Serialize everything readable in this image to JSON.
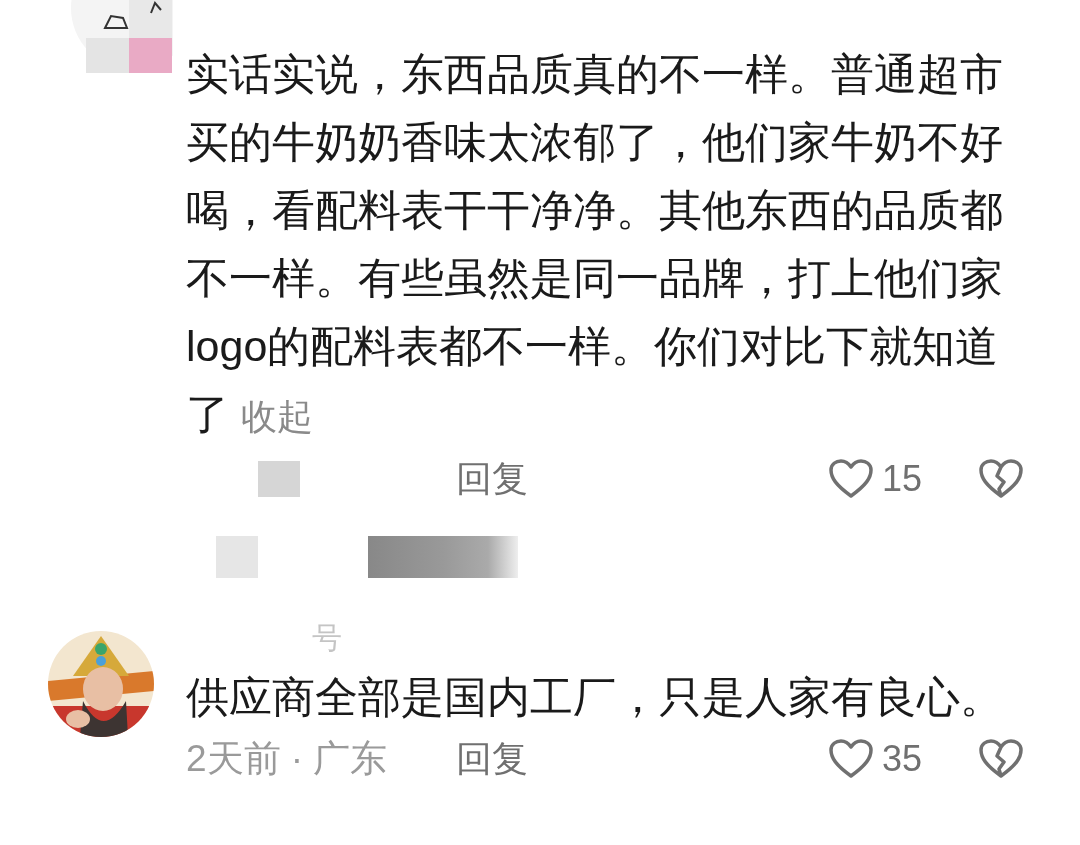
{
  "comments": [
    {
      "text": "实话实说，东西品质真的不一样。普通超市买的牛奶奶香味太浓郁了，他们家牛奶不好喝，看配料表干干净净。其他东西的品质都不一样。有些虽然是同一品牌，打上他们家logo的配料表都不一样。你们对比下就知道了",
      "collapse": "收起",
      "redacted_meta": true,
      "reply": "回复",
      "likes": "15",
      "reply_preview_redacted": true
    },
    {
      "username": "号",
      "text": "供应商全部是国内工厂，只是人家有良心。",
      "meta": "2天前 · 广东",
      "redacted_meta": false,
      "reply": "回复",
      "likes": "35",
      "reply_preview_redacted": false
    }
  ]
}
